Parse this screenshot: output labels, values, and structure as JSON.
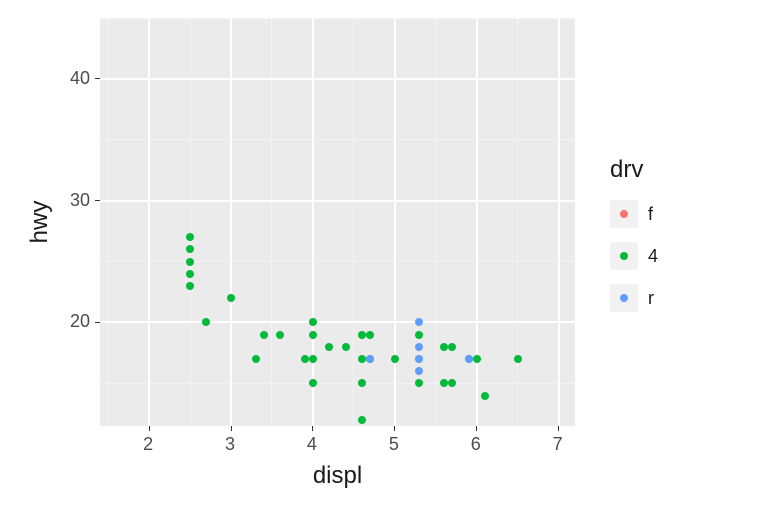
{
  "chart_data": {
    "type": "scatter",
    "title": "",
    "xlabel": "displ",
    "ylabel": "hwy",
    "xlim": [
      1.4,
      7.2
    ],
    "ylim": [
      11.5,
      45
    ],
    "x_ticks": [
      2,
      3,
      4,
      5,
      6,
      7
    ],
    "y_ticks": [
      20,
      30,
      40
    ],
    "x_minor": [
      1.5,
      2.5,
      3.5,
      4.5,
      5.5,
      6.5
    ],
    "y_minor": [
      15,
      25,
      35,
      45
    ],
    "legend": {
      "title": "drv",
      "items": [
        {
          "label": "f",
          "color": "#F8766D"
        },
        {
          "label": "4",
          "color": "#00BA38"
        },
        {
          "label": "r",
          "color": "#619CFF"
        }
      ]
    },
    "series": [
      {
        "name": "4",
        "color": "#00BA38",
        "points": [
          {
            "x": 2.5,
            "y": 23
          },
          {
            "x": 2.5,
            "y": 24
          },
          {
            "x": 2.5,
            "y": 25
          },
          {
            "x": 2.5,
            "y": 26
          },
          {
            "x": 2.5,
            "y": 27
          },
          {
            "x": 2.7,
            "y": 20
          },
          {
            "x": 3.0,
            "y": 22
          },
          {
            "x": 3.3,
            "y": 17
          },
          {
            "x": 3.4,
            "y": 19
          },
          {
            "x": 3.6,
            "y": 19
          },
          {
            "x": 3.9,
            "y": 17
          },
          {
            "x": 4.0,
            "y": 20
          },
          {
            "x": 4.0,
            "y": 19
          },
          {
            "x": 4.0,
            "y": 17
          },
          {
            "x": 4.0,
            "y": 15
          },
          {
            "x": 4.2,
            "y": 18
          },
          {
            "x": 4.4,
            "y": 18
          },
          {
            "x": 4.6,
            "y": 19
          },
          {
            "x": 4.6,
            "y": 17
          },
          {
            "x": 4.6,
            "y": 15
          },
          {
            "x": 4.6,
            "y": 12
          },
          {
            "x": 4.7,
            "y": 19
          },
          {
            "x": 4.7,
            "y": 17
          },
          {
            "x": 5.0,
            "y": 17
          },
          {
            "x": 5.3,
            "y": 19
          },
          {
            "x": 5.3,
            "y": 17
          },
          {
            "x": 5.3,
            "y": 15
          },
          {
            "x": 5.6,
            "y": 18
          },
          {
            "x": 5.6,
            "y": 15
          },
          {
            "x": 5.7,
            "y": 18
          },
          {
            "x": 5.7,
            "y": 15
          },
          {
            "x": 5.9,
            "y": 17
          },
          {
            "x": 6.0,
            "y": 17
          },
          {
            "x": 6.1,
            "y": 14
          },
          {
            "x": 6.5,
            "y": 17
          }
        ]
      },
      {
        "name": "r",
        "color": "#619CFF",
        "points": [
          {
            "x": 4.7,
            "y": 17
          },
          {
            "x": 5.3,
            "y": 20
          },
          {
            "x": 5.3,
            "y": 18
          },
          {
            "x": 5.3,
            "y": 17
          },
          {
            "x": 5.3,
            "y": 16
          },
          {
            "x": 5.9,
            "y": 17
          }
        ]
      }
    ]
  },
  "axes": {
    "x_label": "displ",
    "y_label": "hwy"
  },
  "ticks": {
    "x": {
      "0": "2",
      "1": "3",
      "2": "4",
      "3": "5",
      "4": "6",
      "5": "7"
    },
    "y": {
      "0": "20",
      "1": "30",
      "2": "40"
    }
  },
  "legend": {
    "title": "drv",
    "items": {
      "0": "f",
      "1": "4",
      "2": "r"
    },
    "colors": {
      "0": "#F8766D",
      "1": "#00BA38",
      "2": "#619CFF"
    }
  }
}
